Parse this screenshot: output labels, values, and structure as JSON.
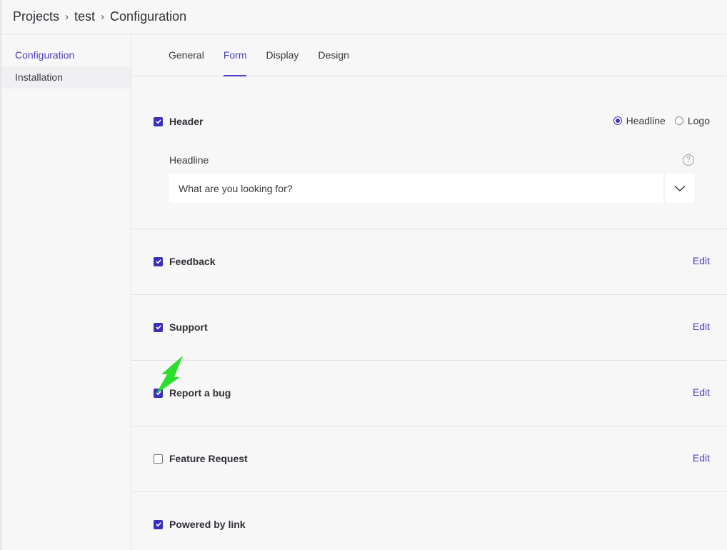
{
  "breadcrumb": {
    "items": [
      "Projects",
      "test",
      "Configuration"
    ]
  },
  "sidebar": {
    "items": [
      {
        "label": "Configuration",
        "active": true
      },
      {
        "label": "Installation",
        "active": false
      }
    ]
  },
  "tabs": [
    {
      "label": "General",
      "active": false
    },
    {
      "label": "Form",
      "active": true
    },
    {
      "label": "Display",
      "active": false
    },
    {
      "label": "Design",
      "active": false
    }
  ],
  "header_section": {
    "label": "Header",
    "checked": true,
    "radio_options": [
      {
        "label": "Headline",
        "selected": true
      },
      {
        "label": "Logo",
        "selected": false
      }
    ],
    "headline_label": "Headline",
    "headline_value": "What are you looking for?",
    "help_glyph": "?"
  },
  "sections": [
    {
      "label": "Feedback",
      "checked": true,
      "edit_label": "Edit"
    },
    {
      "label": "Support",
      "checked": true,
      "edit_label": "Edit"
    },
    {
      "label": "Report a bug",
      "checked": true,
      "edit_label": "Edit"
    },
    {
      "label": "Feature Request",
      "checked": false,
      "edit_label": "Edit"
    },
    {
      "label": "Powered by link",
      "checked": true,
      "edit_label": ""
    }
  ],
  "colors": {
    "accent": "#4b3fc4",
    "checkbox": "#3c2fb8",
    "pointer": "#22dd22"
  }
}
